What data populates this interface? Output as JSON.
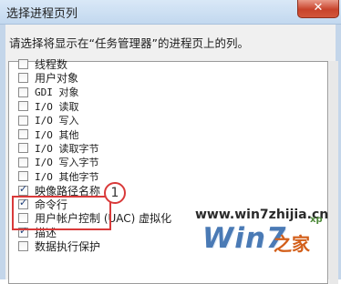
{
  "window": {
    "title": "选择进程页列",
    "close_glyph": "✕"
  },
  "instruction": "请选择将显示在“任务管理器”的进程页上的列。",
  "columns": [
    {
      "label": "线程数",
      "checked": false,
      "mono": false
    },
    {
      "label": "用户对象",
      "checked": false,
      "mono": false
    },
    {
      "label": "GDI 对象",
      "checked": false,
      "mono": true
    },
    {
      "label": "I/O 读取",
      "checked": false,
      "mono": true
    },
    {
      "label": "I/O 写入",
      "checked": false,
      "mono": true
    },
    {
      "label": "I/O 其他",
      "checked": false,
      "mono": true
    },
    {
      "label": "I/O 读取字节",
      "checked": false,
      "mono": true
    },
    {
      "label": "I/O 写入字节",
      "checked": false,
      "mono": true
    },
    {
      "label": "I/O 其他字节",
      "checked": false,
      "mono": true
    },
    {
      "label": "映像路径名称",
      "checked": true,
      "mono": false
    },
    {
      "label": "命令行",
      "checked": true,
      "mono": false
    },
    {
      "label": "用户帐户控制 (UAC) 虚拟化",
      "checked": false,
      "mono": false
    },
    {
      "label": "描述",
      "checked": true,
      "mono": false
    },
    {
      "label": "数据执行保护",
      "checked": false,
      "mono": false
    }
  ],
  "annotation": {
    "number": "1",
    "color": "#d93a3a"
  },
  "watermark": {
    "url": "www.win7zhijia.cn",
    "logo": "Win7",
    "sub": "之家",
    "tag": "xp"
  }
}
